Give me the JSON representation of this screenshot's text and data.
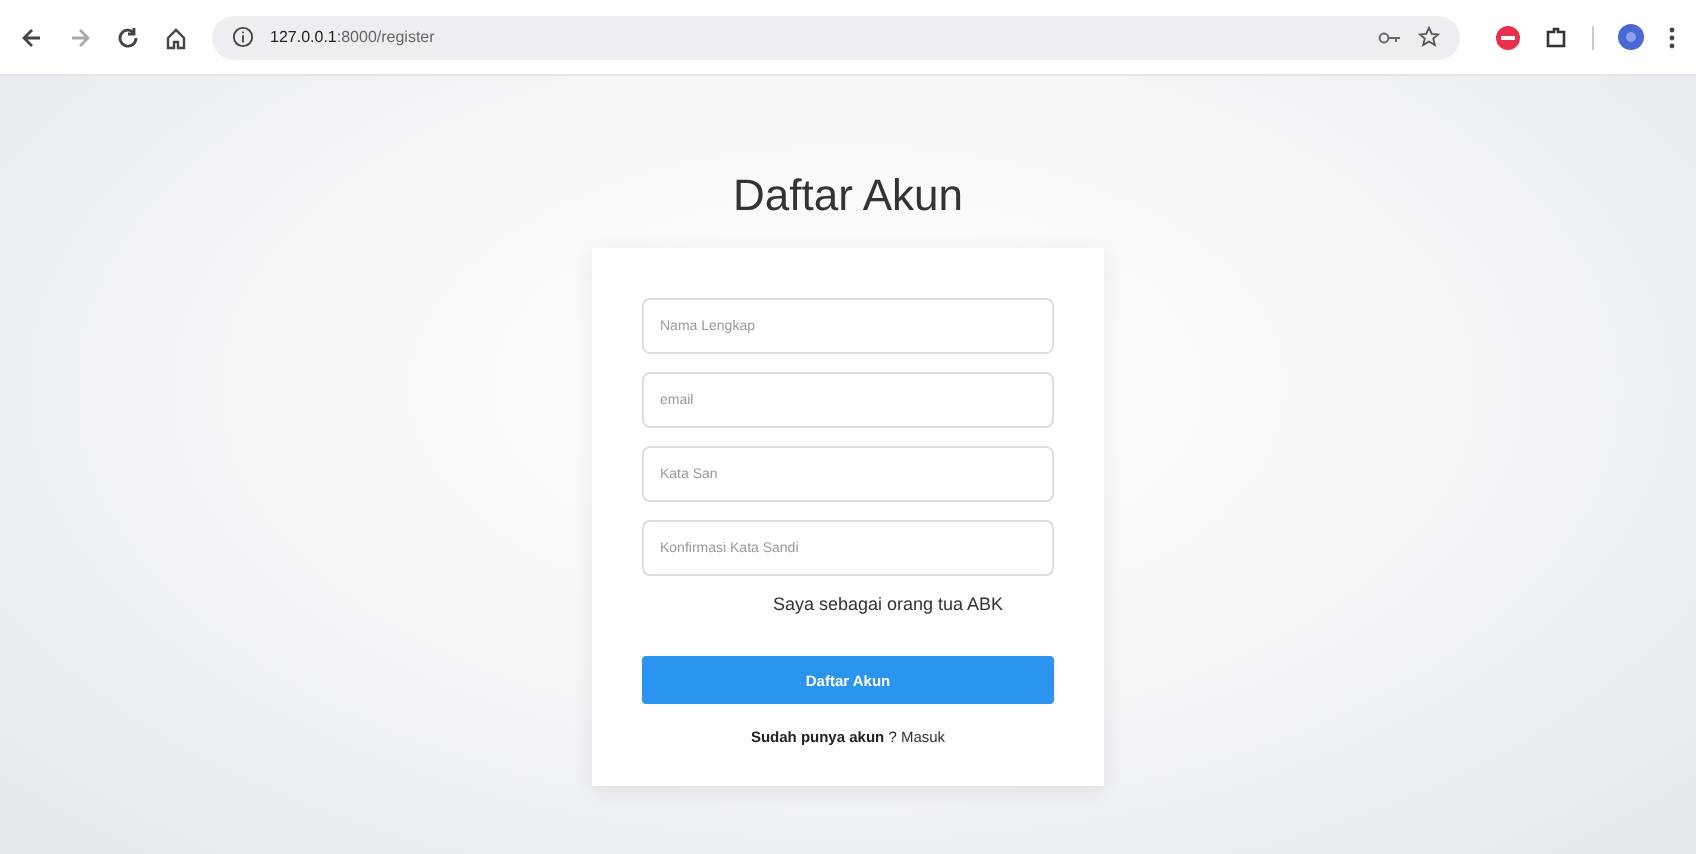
{
  "browser": {
    "url_host": "127.0.0.1",
    "url_rest": ":8000/register"
  },
  "page": {
    "title": "Daftar Akun",
    "fields": [
      {
        "placeholder": "Nama Lengkap"
      },
      {
        "placeholder": "email"
      },
      {
        "placeholder": "Kata San"
      },
      {
        "placeholder": "Konfirmasi Kata Sandi"
      }
    ],
    "note": "Saya sebagai orang tua ABK",
    "submit": "Daftar Akun",
    "footer": {
      "text": "**Sudah punya akun** ? ",
      "link": "Masuk"
    }
  }
}
